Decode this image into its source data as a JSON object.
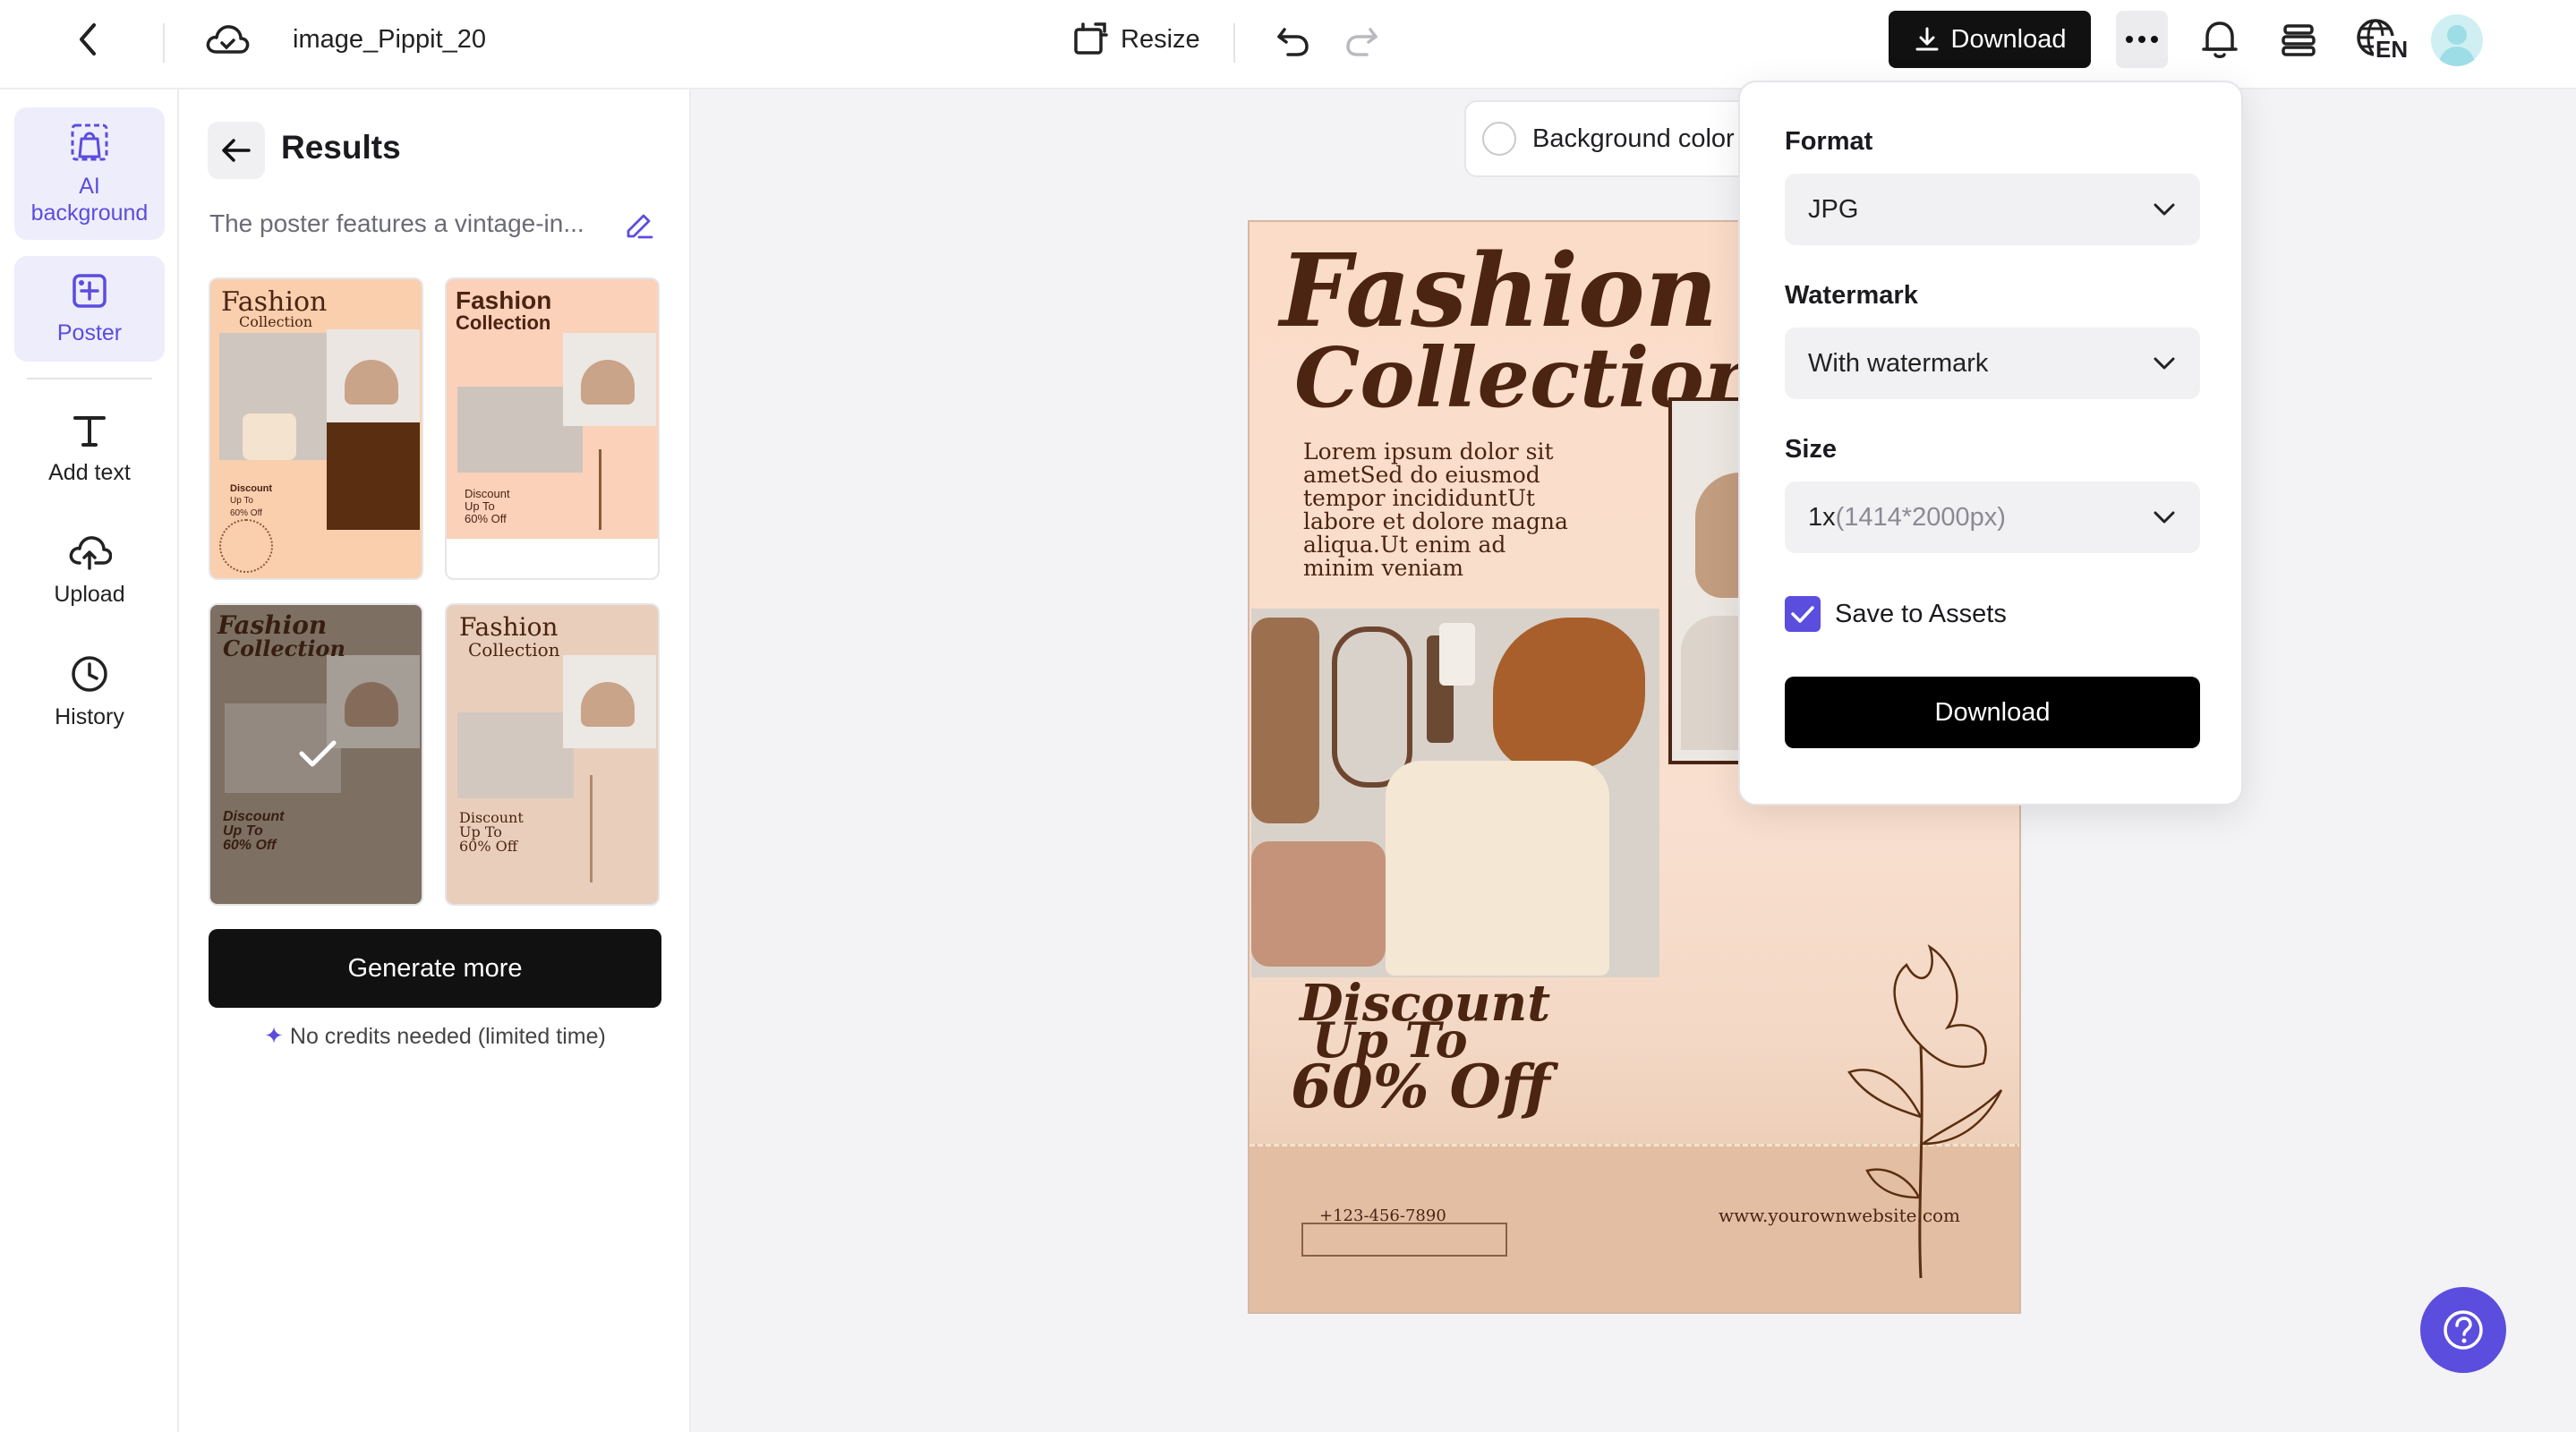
{
  "topbar": {
    "file_name": "image_Pippit_20",
    "resize_label": "Resize",
    "download_label": "Download",
    "language_badge": "EN"
  },
  "rail": {
    "items": [
      {
        "label": "AI background",
        "icon": "ai-background-icon",
        "active": true
      },
      {
        "label": "Poster",
        "icon": "poster-icon",
        "active": true
      },
      {
        "label": "Add text",
        "icon": "text-icon"
      },
      {
        "label": "Upload",
        "icon": "upload-cloud-icon"
      },
      {
        "label": "History",
        "icon": "clock-icon"
      }
    ]
  },
  "panel": {
    "title": "Results",
    "prompt": "The poster features a vintage-in...",
    "generate_more": "Generate more",
    "no_credits": "No credits needed (limited time)",
    "thumbnails": [
      {
        "title_a": "Fashion",
        "title_b": "Collection",
        "discount_a": "Discount",
        "discount_b": "Up To",
        "discount_c": "60% Off"
      },
      {
        "title_a": "Fashion",
        "title_b": "Collection",
        "discount_a": "Discount",
        "discount_b": "Up To",
        "discount_c": "60% Off"
      },
      {
        "title_a": "Fashion",
        "title_b": "Collection",
        "discount_a": "Discount",
        "discount_b": "Up To",
        "discount_c": "60% Off",
        "selected": true
      },
      {
        "title_a": "Fashion",
        "title_b": "Collection",
        "discount_a": "Discount",
        "discount_b": "Up To",
        "discount_c": "60% Off"
      }
    ]
  },
  "canvas": {
    "bg_color_label": "Background color"
  },
  "poster": {
    "title_a": "Fashion",
    "title_b": "Collection",
    "body": [
      "Lorem ipsum dolor sit",
      "ametSed do eiusmod",
      "tempor incididuntUt",
      "labore et dolore magna",
      "aliqua.Ut enim ad",
      "minim veniam"
    ],
    "discount_a": "Discount",
    "discount_b": "Up To",
    "discount_c": "60% Off",
    "phone": "+123-456-7890",
    "website": "www.yourownwebsite.com"
  },
  "download_popover": {
    "format_label": "Format",
    "format_value": "JPG",
    "watermark_label": "Watermark",
    "watermark_value": "With watermark",
    "size_label": "Size",
    "size_value_main": "1x",
    "size_value_sub": "(1414*2000px)",
    "save_to_assets": "Save to Assets",
    "save_checked": true,
    "download_label": "Download"
  },
  "colors": {
    "accent": "#5b4dde",
    "dark_button": "#111111",
    "poster_brown": "#4b2412",
    "poster_peach": "#fbdcc8"
  }
}
